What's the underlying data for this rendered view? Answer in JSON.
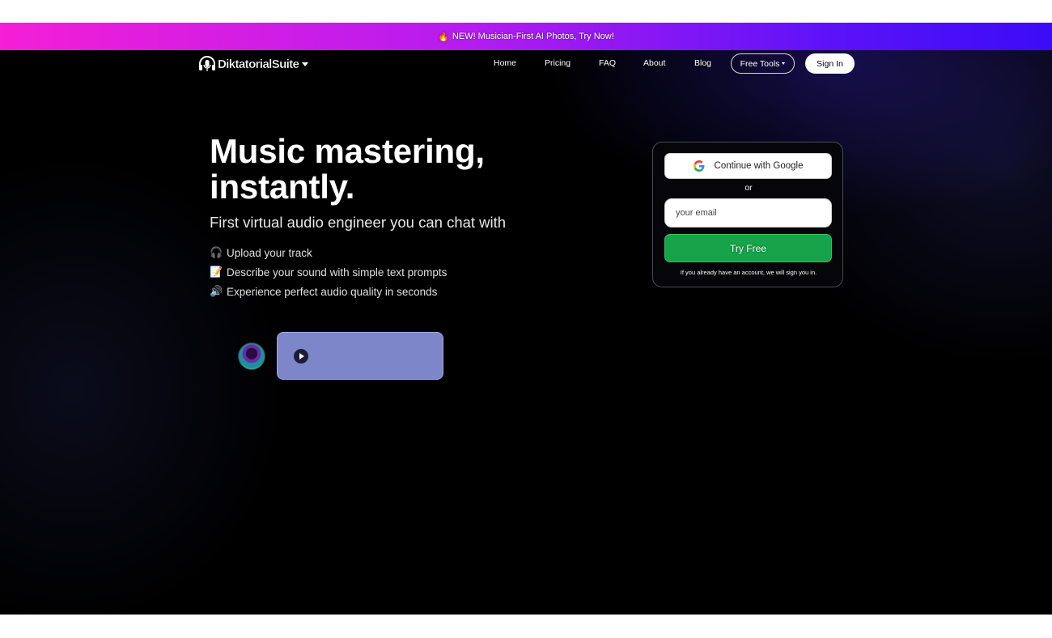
{
  "banner": {
    "icon": "fire-icon",
    "emoji": "🔥",
    "text": "NEW! Musician-First AI Photos, Try Now!"
  },
  "nav": {
    "brand": "DiktatorialSuite",
    "brand_icon": "headphones-microphone-icon",
    "links": [
      "Home",
      "Pricing",
      "FAQ",
      "About",
      "Blog"
    ],
    "free_tools": "Free Tools",
    "sign_in": "Sign In"
  },
  "hero": {
    "title": "Music mastering, instantly.",
    "subtitle": "First virtual audio engineer you can chat with",
    "features": [
      {
        "emoji": "🎧",
        "icon": "headphones-icon",
        "text": "Upload your track"
      },
      {
        "emoji": "📝",
        "icon": "memo-icon",
        "text": "Describe your sound with simple text prompts"
      },
      {
        "emoji": "🔊",
        "icon": "speaker-icon",
        "text": "Experience perfect audio quality in seconds"
      }
    ]
  },
  "signup": {
    "google_label": "Continue with Google",
    "or_label": "or",
    "email_placeholder": "your email",
    "email_value": "",
    "submit_label": "Try Free",
    "note": "If you already have an account, we will sign you in."
  },
  "colors": {
    "banner_start": "#f41fd6",
    "banner_end": "#3b0cf6",
    "background": "#000000",
    "cta_green": "#16a34a",
    "player_bg": "#7c86c8"
  }
}
